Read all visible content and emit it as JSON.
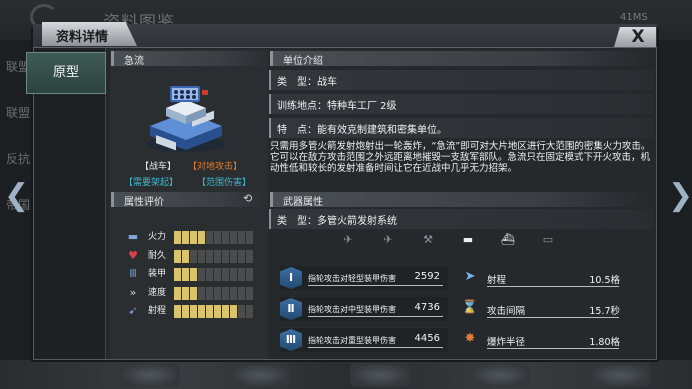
{
  "background": {
    "title": "资料图鉴",
    "time": "41MS",
    "side_tabs": [
      "联盟",
      "联盟",
      "反抗",
      "帝国"
    ]
  },
  "dialog": {
    "title": "资料详情",
    "close_label": "X",
    "side_tab": "原型"
  },
  "unit": {
    "section_label": "急流",
    "tags": [
      {
        "text": "【战车】",
        "color": "#e8e8e8"
      },
      {
        "text": "【对地攻击】",
        "color": "#e07a2f"
      },
      {
        "text": "【需要架起】",
        "color": "#3fb5c9"
      },
      {
        "text": "【范围伤害】",
        "color": "#3fb5c9"
      }
    ],
    "attr_label": "属性评价",
    "stats": [
      {
        "icon": "firepower-icon",
        "glyph": "▬",
        "name": "火力",
        "level": 4,
        "max": 10
      },
      {
        "icon": "heart-icon",
        "glyph": "♥",
        "name": "耐久",
        "level": 2,
        "max": 10
      },
      {
        "icon": "armor-icon",
        "glyph": "Ⅲ",
        "name": "装甲",
        "level": 3,
        "max": 10
      },
      {
        "icon": "speed-icon",
        "glyph": "»",
        "name": "速度",
        "level": 3,
        "max": 10
      },
      {
        "icon": "range-icon",
        "glyph": "➹",
        "name": "射程",
        "level": 8,
        "max": 10
      }
    ]
  },
  "intro": {
    "section_label": "单位介绍",
    "type_label": "类　型：",
    "type_value": "战车",
    "train_label": "训练地点：",
    "train_value": "特种车工厂 2级",
    "feature_label": "特　点：",
    "feature_value": "能有效克制建筑和密集单位。",
    "description": "只需用多管火箭发射炮射出一轮轰炸，“急流”即可对大片地区进行大范围的密集火力攻击。它可以在敌方攻击范围之外远距离地摧毁一支敌军部队。急流只在固定模式下开火攻击，机动性低和较长的发射准备时间让它在近战中几乎无力招架。"
  },
  "weapon": {
    "section_label": "武器属性",
    "type_label": "类　型：",
    "type_value": "多管火箭发射系统",
    "target_icons": [
      {
        "icon": "infantry-icon",
        "glyph": "✈",
        "active": false
      },
      {
        "icon": "aircraft-icon",
        "glyph": "✈",
        "active": false
      },
      {
        "icon": "helicopter-icon",
        "glyph": "⚒",
        "active": false
      },
      {
        "icon": "tank-icon",
        "glyph": "▬",
        "active": true
      },
      {
        "icon": "ship-icon",
        "glyph": "⛴",
        "active": true
      },
      {
        "icon": "submarine-icon",
        "glyph": "▭",
        "active": false
      }
    ],
    "attacks": [
      {
        "icon": "light-armor-icon",
        "badge": "Ⅰ",
        "label": "指轮攻击对轻型装甲伤害",
        "value": "2592"
      },
      {
        "icon": "medium-armor-icon",
        "badge": "Ⅱ",
        "label": "指轮攻击对中型装甲伤害",
        "value": "4736"
      },
      {
        "icon": "heavy-armor-icon",
        "badge": "Ⅲ",
        "label": "指轮攻击对重型装甲伤害",
        "value": "4456"
      }
    ],
    "props": [
      {
        "icon": "range-arrow-icon",
        "glyph": "➤",
        "label": "射程",
        "value": "10.5格"
      },
      {
        "icon": "hourglass-icon",
        "glyph": "⌛",
        "label": "攻击间隔",
        "value": "15.7秒"
      },
      {
        "icon": "explosion-icon",
        "glyph": "✸",
        "label": "爆炸半径",
        "value": "1.80格"
      }
    ]
  }
}
